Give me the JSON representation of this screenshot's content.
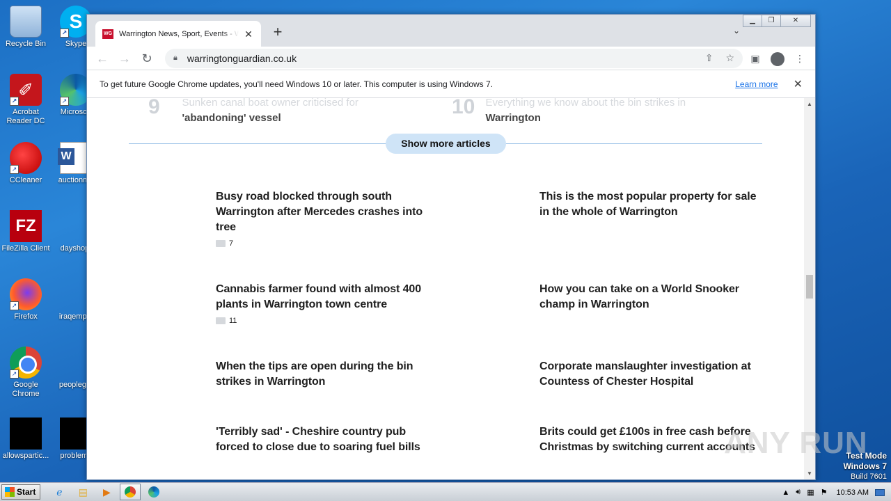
{
  "desktop": {
    "icons": [
      {
        "label": "Recycle Bin",
        "icon": "recycle-bin-icon"
      },
      {
        "label": "Skype",
        "icon": "skype-icon"
      },
      {
        "label": "Acrobat Reader DC",
        "icon": "acrobat-icon"
      },
      {
        "label": "Microsoft",
        "icon": "edge-icon"
      },
      {
        "label": "CCleaner",
        "icon": "ccleaner-icon"
      },
      {
        "label": "auctionme",
        "icon": "word-document-icon"
      },
      {
        "label": "FileZilla Client",
        "icon": "filezilla-icon"
      },
      {
        "label": "dayshop.",
        "icon": "file-icon"
      },
      {
        "label": "Firefox",
        "icon": "firefox-icon"
      },
      {
        "label": "iraqemplo",
        "icon": "file-icon"
      },
      {
        "label": "Google Chrome",
        "icon": "chrome-icon"
      },
      {
        "label": "peopleget",
        "icon": "file-icon"
      },
      {
        "label": "allowspartic...",
        "icon": "black-file-icon"
      },
      {
        "label": "problems",
        "icon": "black-file-icon"
      }
    ]
  },
  "browser": {
    "tab_title": "Warrington News, Sport, Events - W",
    "favicon_text": "WG",
    "url": "warringtonguardian.co.uk",
    "infobar_message": "To get future Google Chrome updates, you'll need Windows 10 or later. This computer is using Windows 7.",
    "infobar_link": "Learn more"
  },
  "page": {
    "faded_items": [
      {
        "num": "9",
        "text": "Sunken canal boat owner criticised for",
        "text2": "'abandoning' vessel"
      },
      {
        "num": "10",
        "text": "Everything we know about the bin strikes in",
        "text2": "Warrington"
      }
    ],
    "show_more_label": "Show more articles",
    "articles": [
      {
        "headline": "Busy road blocked through south Warrington after Mercedes crashes into tree",
        "comments": "7"
      },
      {
        "headline": "This is the most popular property for sale in the whole of Warrington",
        "comments": ""
      },
      {
        "headline": "Cannabis farmer found with almost 400 plants in Warrington town centre",
        "comments": "11"
      },
      {
        "headline": "How you can take on a World Snooker champ in Warrington",
        "comments": ""
      },
      {
        "headline": "When the tips are open during the bin strikes in Warrington",
        "comments": ""
      },
      {
        "headline": "Corporate manslaughter investigation at Countess of Chester Hospital",
        "comments": ""
      },
      {
        "headline": "'Terribly sad' - Cheshire country pub forced to close due to soaring fuel bills",
        "comments": ""
      },
      {
        "headline": "Brits could get £100s in free cash before Christmas by switching current accounts",
        "comments": ""
      }
    ]
  },
  "taskbar": {
    "start_label": "Start",
    "clock": "10:53 AM"
  },
  "watermark": {
    "line1": "Test Mode",
    "line2": "Windows 7",
    "line3": "Build 7601",
    "brand": "ANY RUN"
  }
}
